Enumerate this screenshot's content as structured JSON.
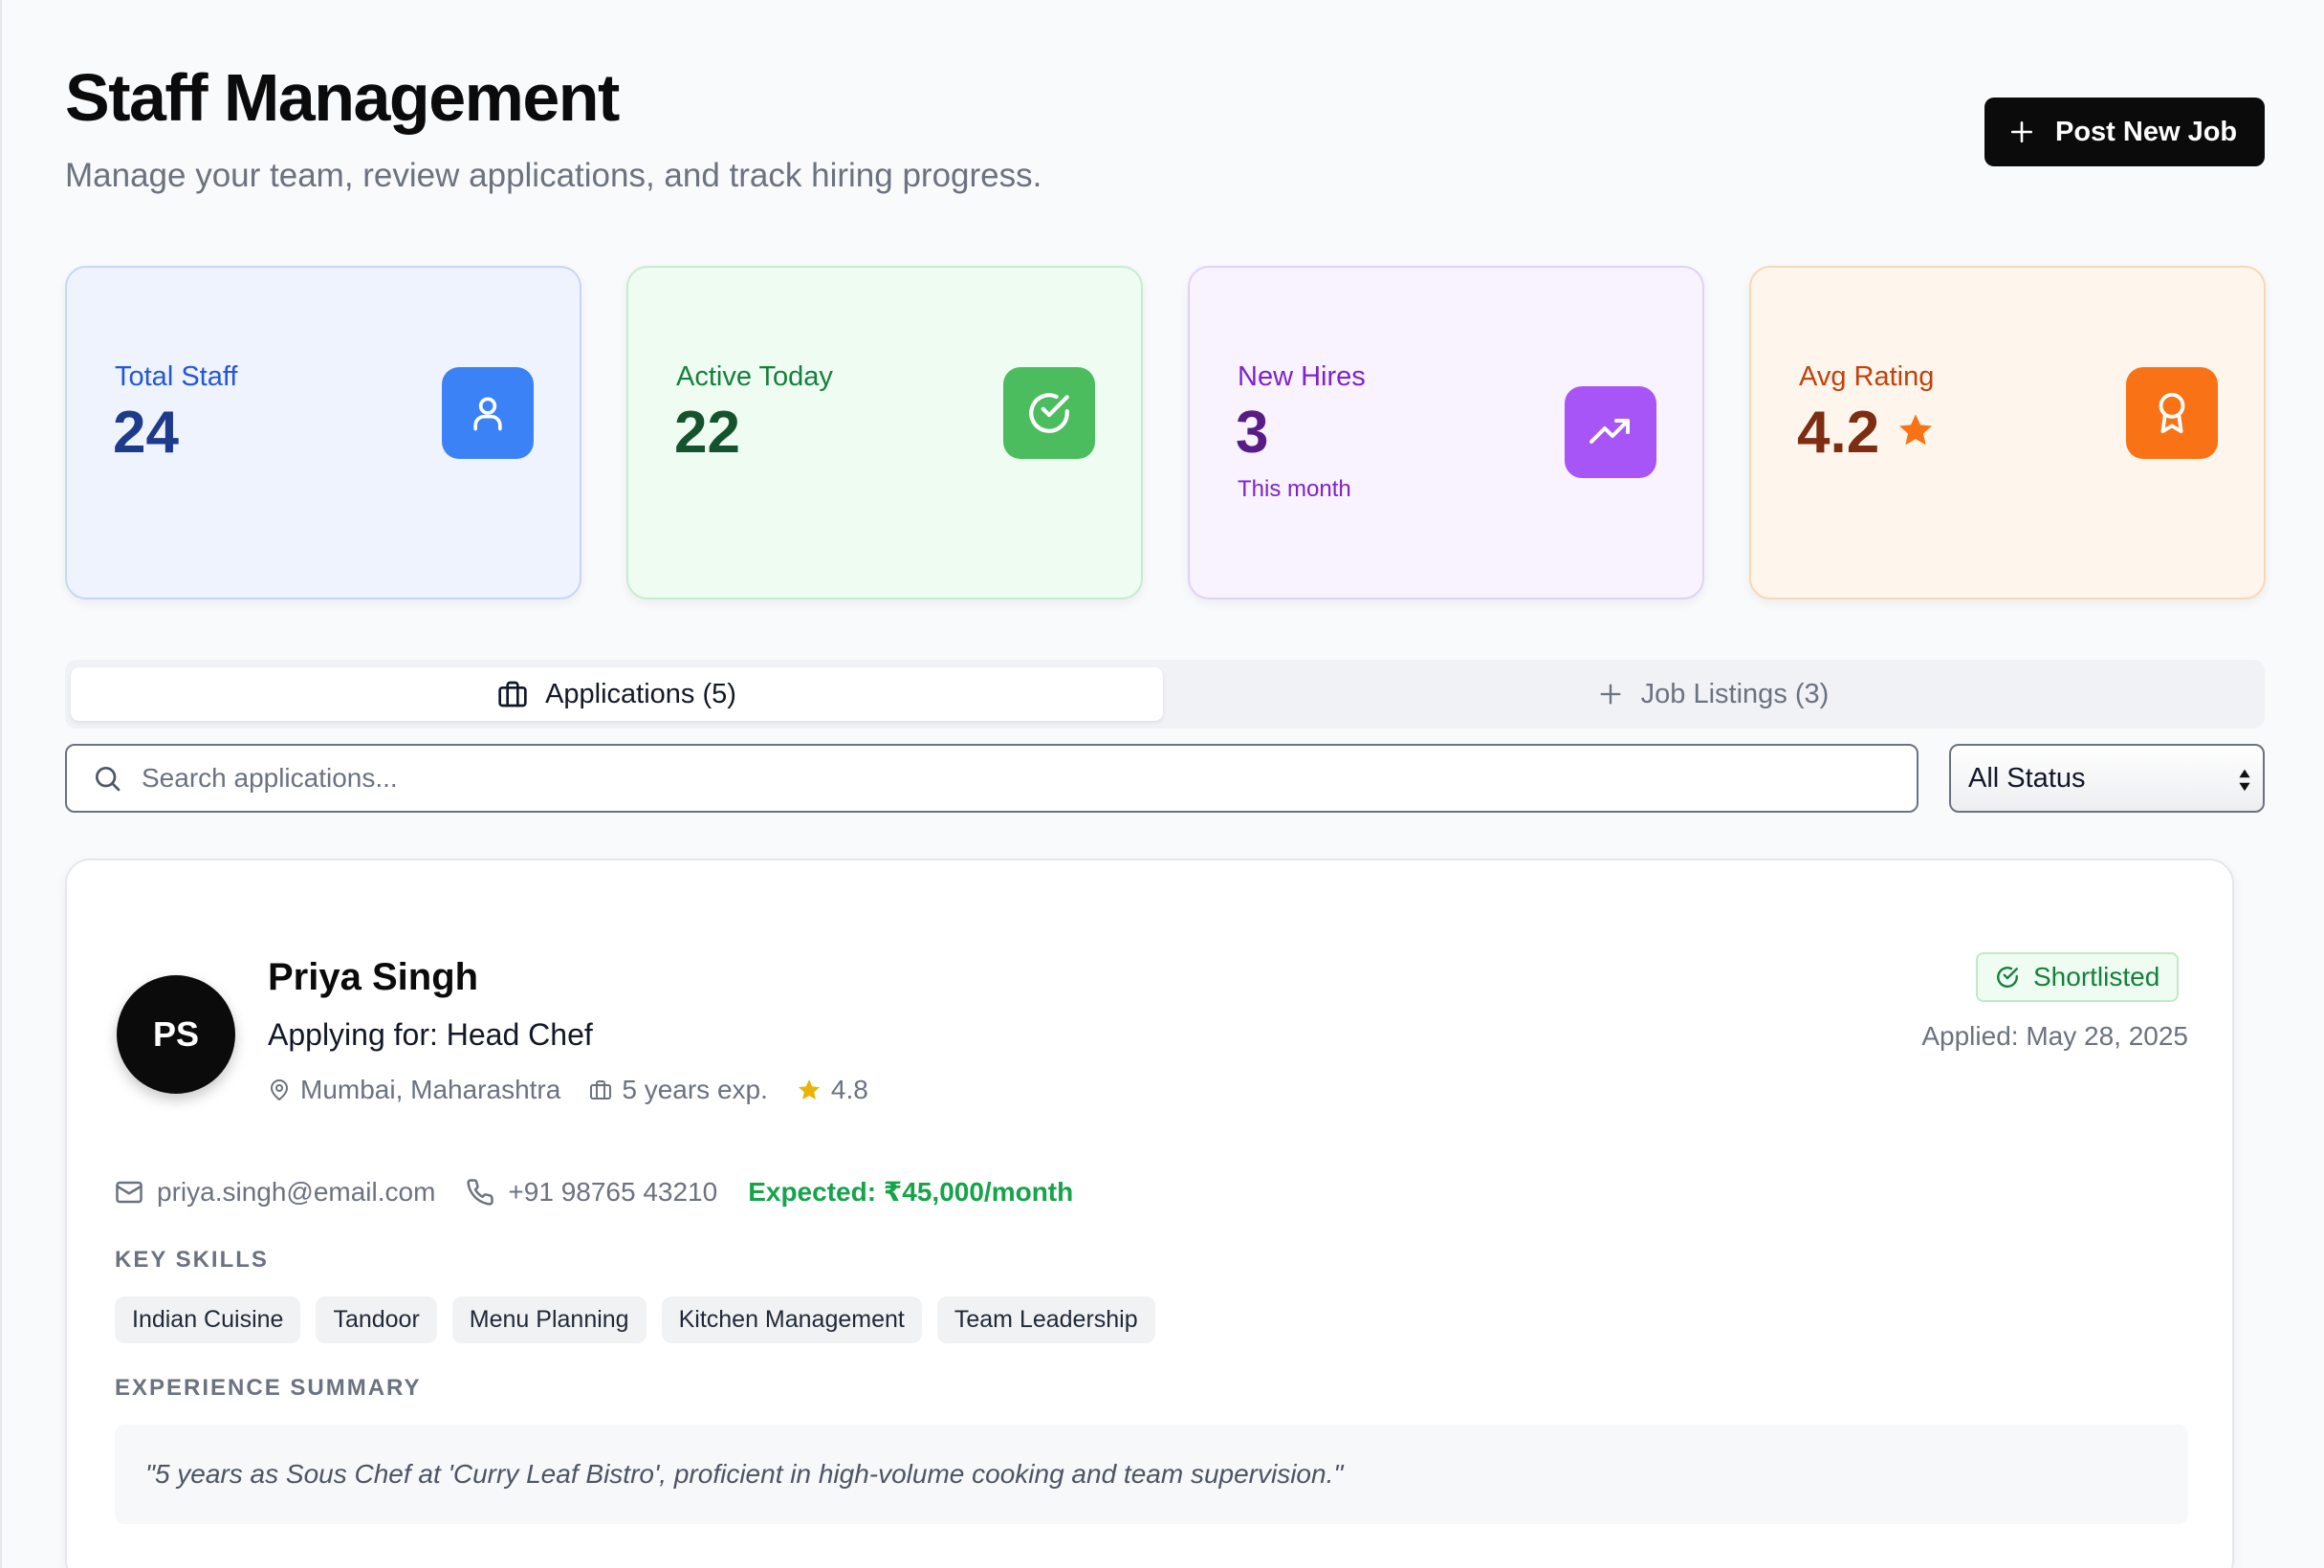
{
  "header": {
    "title": "Staff Management",
    "subtitle": "Manage your team, review applications, and track hiring progress.",
    "post_job_label": "Post New Job"
  },
  "stats": [
    {
      "label": "Total Staff",
      "value": "24",
      "icon": "user-icon"
    },
    {
      "label": "Active Today",
      "value": "22",
      "icon": "check-circle-icon"
    },
    {
      "label": "New Hires",
      "value": "3",
      "extra": "This month",
      "icon": "trending-up-icon"
    },
    {
      "label": "Avg Rating",
      "value": "4.2",
      "icon": "award-icon"
    }
  ],
  "tabs": [
    {
      "label": "Applications (5)",
      "active": true,
      "icon": "briefcase-icon"
    },
    {
      "label": "Job Listings (3)",
      "active": false,
      "icon": "plus-icon"
    }
  ],
  "search": {
    "placeholder": "Search applications...",
    "value": ""
  },
  "status_filter": {
    "selected": "All Status"
  },
  "application": {
    "initials": "PS",
    "name": "Priya Singh",
    "applying_for": "Applying for: Head Chef",
    "location": "Mumbai, Maharashtra",
    "experience": "5 years exp.",
    "rating": "4.8",
    "status": "Shortlisted",
    "applied": "Applied: May 28, 2025",
    "email": "priya.singh@email.com",
    "phone": "+91 98765 43210",
    "expected": "Expected: ₹45,000/month",
    "skills_label": "KEY SKILLS",
    "skills": [
      "Indian Cuisine",
      "Tandoor",
      "Menu Planning",
      "Kitchen Management",
      "Team Leadership"
    ],
    "summary_label": "EXPERIENCE SUMMARY",
    "summary": "\"5 years as Sous Chef at 'Curry Leaf Bistro', proficient in high-volume cooking and team supervision.\""
  },
  "colors": {
    "primary_button": "#0b0b0c",
    "blue": "#3b82f6",
    "green": "#4cbd5e",
    "purple": "#a855f7",
    "orange": "#f97316",
    "star": "#eab308"
  }
}
